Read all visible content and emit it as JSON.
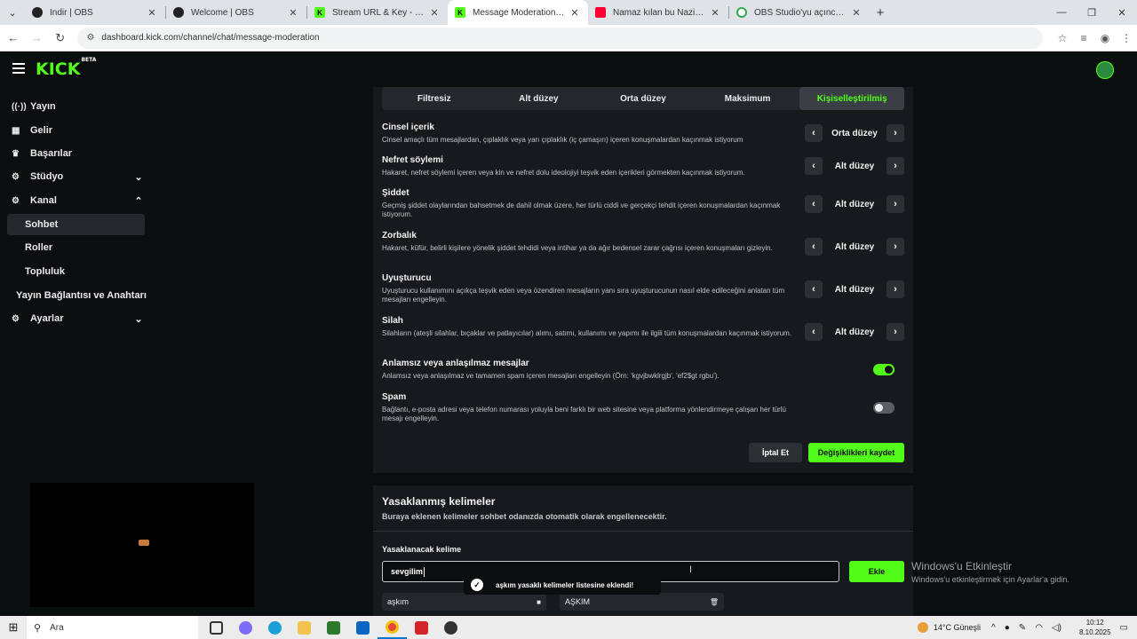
{
  "browser": {
    "tabs": [
      {
        "title": "İndir | OBS",
        "color": "#222222",
        "glyph": ""
      },
      {
        "title": "Welcome | OBS",
        "color": "#222222",
        "glyph": ""
      },
      {
        "title": "Stream URL & Key - Kick Dashb",
        "color": "#53fc18",
        "glyph": "K"
      },
      {
        "title": "Message Moderation - Kick Da",
        "color": "#53fc18",
        "glyph": "K"
      },
      {
        "title": "Namaz kılan bu Naziler kimdi?",
        "color": "#ff0033",
        "glyph": ""
      },
      {
        "title": "OBS Studio'yu açınca ses gelm",
        "color": "#34a853",
        "glyph": ""
      }
    ],
    "active_tab": 3,
    "url": "dashboard.kick.com/channel/chat/message-moderation"
  },
  "header": {
    "logo": "KICK",
    "logo_badge": "BETA"
  },
  "sidebar": {
    "items": [
      {
        "label": "Yayın",
        "icon": "broadcast-icon"
      },
      {
        "label": "Gelir",
        "icon": "revenue-icon"
      },
      {
        "label": "Başarılar",
        "icon": "trophy-icon"
      },
      {
        "label": "Stüdyo",
        "icon": "studio-icon"
      },
      {
        "label": "Kanal",
        "icon": "channel-icon"
      },
      {
        "label": "Sohbet"
      },
      {
        "label": "Roller"
      },
      {
        "label": "Topluluk"
      },
      {
        "label": "Yayın Bağlantısı ve Anahtarı"
      },
      {
        "label": "Ayarlar",
        "icon": "settings-icon"
      }
    ]
  },
  "moderation": {
    "levels": [
      "Filtresiz",
      "Alt düzey",
      "Orta düzey",
      "Maksimum",
      "Kişiselleştirilmiş"
    ],
    "active_level": 4,
    "rules": [
      {
        "title": "Cinsel içerik",
        "desc": "Cinsel amaçlı tüm mesajlardan, çıplaklık veya yarı çıplaklık (iç çamaşırı) içeren konuşmalardan kaçınmak istiyorum",
        "value": "Orta düzey"
      },
      {
        "title": "Nefret söylemi",
        "desc": "Hakaret, nefret söylemi içeren veya kin ve nefret dolu ideolojiyi teşvik eden içerikleri görmekten kaçınmak istiyorum.",
        "value": "Alt düzey"
      },
      {
        "title": "Şiddet",
        "desc": "Geçmiş şiddet olaylarından bahsetmek de dahil olmak üzere, her türlü ciddi ve gerçekçi tehdit içeren konuşmalardan kaçınmak istiyorum.",
        "value": "Alt düzey"
      },
      {
        "title": "Zorbalık",
        "desc": "Hakaret, küfür, belirli kişilere yönelik şiddet tehdidi veya intihar ya da ağır bedensel zarar çağrısı içeren konuşmaları gizleyin.",
        "value": "Alt düzey"
      },
      {
        "title": "Uyuşturucu",
        "desc": "Uyuşturucu kullanımını açıkça teşvik eden veya özendiren mesajların yanı sıra uyuşturucunun nasıl elde edileceğini anlatan tüm mesajları engelleyin.",
        "value": "Alt düzey"
      },
      {
        "title": "Silah",
        "desc": "Silahların (ateşli silahlar, bıçaklar ve patlayıcılar) alımı, satımı, kullanımı ve yapımı ile ilgili tüm konuşmalardan kaçınmak istiyorum.",
        "value": "Alt düzey"
      }
    ],
    "toggles": [
      {
        "title": "Anlamsız veya anlaşılmaz mesajlar",
        "desc": "Anlamsız veya anlaşılmaz ve tamamen spam içeren mesajları engelleyin (Örn: 'kgvjbwklrgjb', 'ef2$gt rgbu').",
        "on": true
      },
      {
        "title": "Spam",
        "desc": "Bağlantı, e-posta adresi veya telefon numarası yoluyla beni farklı bir web sitesine veya platforma yönlendirmeye çalışan her türlü mesajı engelleyin.",
        "on": false
      }
    ],
    "cancel_label": "İptal Et",
    "save_label": "Değişiklikleri kaydet"
  },
  "banned": {
    "title": "Yasaklanmış kelimeler",
    "subtitle": "Buraya eklenen kelimeler sohbet odanızda otomatik olarak engellenecektir.",
    "field_label": "Yasaklanacak kelime",
    "input_value": "sevgilim",
    "add_label": "Ekle",
    "toast": "aşkım yasaklı kelimeler listesine eklendi!",
    "words": [
      "aşkım",
      "AŞKIM"
    ]
  },
  "watermark": {
    "title": "Windows'u Etkinleştir",
    "subtitle": "Windows'u etkinleştirmek için Ayarlar'a gidin."
  },
  "taskbar": {
    "search_placeholder": "Ara",
    "weather": "14°C  Güneşli",
    "time": "10:12",
    "date": "8.10.2025"
  }
}
